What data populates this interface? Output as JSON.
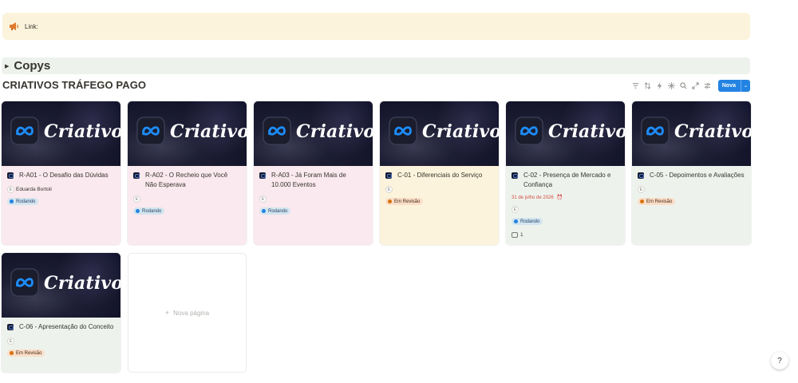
{
  "callout": {
    "icon": "megaphone-icon",
    "text": "Link:"
  },
  "toggle": {
    "title": "Copys"
  },
  "database": {
    "title": "CRIATIVOS TRÁFEGO PAGO",
    "new_button": "Nova"
  },
  "cover_text": "Criativo",
  "cards": [
    {
      "title": "R-A01 - O Desafio das Dúvidas",
      "color": "pink",
      "person": "Eduarda Bortoli",
      "status": "Rodando",
      "status_color": "blue"
    },
    {
      "title": "R-A02 - O Recheio que Você Não Esperava",
      "color": "pink",
      "status": "Rodando",
      "status_color": "blue"
    },
    {
      "title": "R-A03 - Já Foram Mais de 10.000 Eventos",
      "color": "pink",
      "status": "Rodando",
      "status_color": "blue"
    },
    {
      "title": "C-01 - Diferenciais do Serviço",
      "color": "yellow",
      "status": "Em Revisão",
      "status_color": "orange"
    },
    {
      "title": "C-02 - Presença de Mercado e Confiança",
      "color": "green",
      "date": "31 de julho de 2026",
      "status": "Rodando",
      "status_color": "blue",
      "comments": "1"
    },
    {
      "title": "C-05 - Depoimentos e Avaliações",
      "color": "green",
      "status": "Em Revisão",
      "status_color": "orange"
    },
    {
      "title": "C-06 - Apresentação do Conceito",
      "color": "green",
      "status": "Em Revisão",
      "status_color": "orange"
    }
  ],
  "new_page": "Nova página",
  "avatar_initials": "E"
}
